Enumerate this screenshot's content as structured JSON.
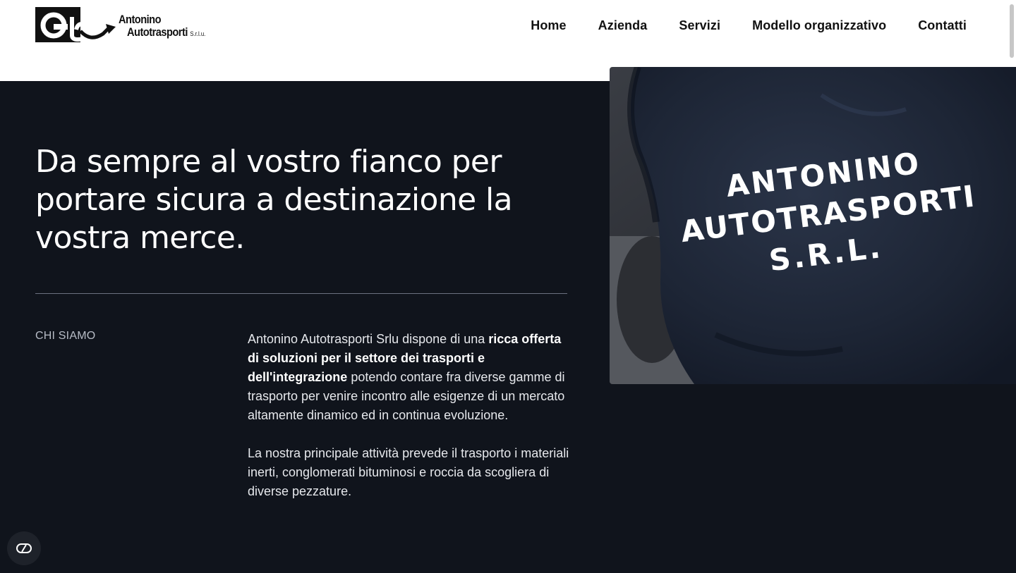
{
  "header": {
    "logo": {
      "line1": "Antonino",
      "line2": "Autotrasporti",
      "suffix": "S.r.l.u."
    },
    "nav": [
      "Home",
      "Azienda",
      "Servizi",
      "Modello organizzativo",
      "Contatti"
    ]
  },
  "hero": {
    "headline": "Da sempre al vostro fianco per portare sicura a destinazione la vostra merce.",
    "photo": {
      "shirt_lines": [
        "ANTONINO",
        "AUTOTRASPORTI",
        "S.R.L."
      ]
    }
  },
  "about": {
    "label": "CHI SIAMO",
    "paragraph1": {
      "intro": "Antonino Autotrasporti Srlu dispone di una ",
      "bold": "ricca offerta di soluzioni per il settore dei trasporti e dell'integrazione",
      "rest": " potendo contare fra diverse gamme di trasporto per venire incontro alle esigenze di un mercato altamente dinamico ed in continua evoluzione."
    },
    "paragraph2": "La nostra principale attività prevede il trasporto i materiali inerti, conglomerati bituminosi e roccia da scogliera di diverse pezzature."
  },
  "cookie_button": {
    "icon": "cookie-settings-icon"
  },
  "colors": {
    "background": "#10141c",
    "header": "#ffffff",
    "text": "#ffffff",
    "divider": "#6b7180"
  }
}
